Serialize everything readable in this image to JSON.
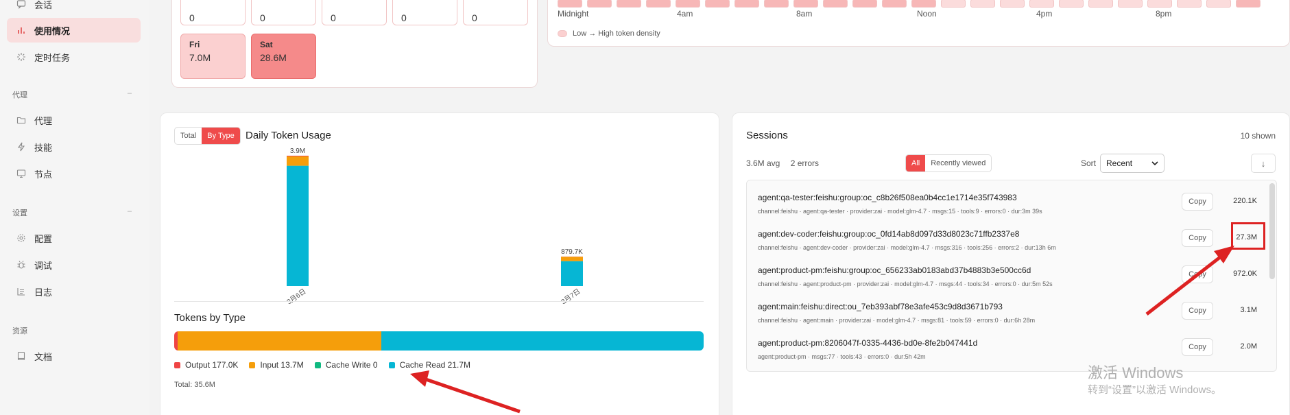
{
  "sidebar": {
    "items": [
      {
        "label": "会话",
        "icon": "chat-icon"
      },
      {
        "label": "使用情况",
        "icon": "bar-chart-icon",
        "active": true
      },
      {
        "label": "定时任务",
        "icon": "spinner-icon"
      }
    ],
    "sections": [
      {
        "title": "代理",
        "items": [
          {
            "label": "代理",
            "icon": "folder-icon"
          },
          {
            "label": "技能",
            "icon": "bolt-icon"
          },
          {
            "label": "节点",
            "icon": "monitor-icon"
          }
        ]
      },
      {
        "title": "设置",
        "items": [
          {
            "label": "配置",
            "icon": "gear-icon"
          },
          {
            "label": "调试",
            "icon": "bug-icon"
          },
          {
            "label": "日志",
            "icon": "log-icon"
          }
        ]
      },
      {
        "title": "资源",
        "items": [
          {
            "label": "文档",
            "icon": "book-icon"
          }
        ]
      }
    ]
  },
  "day_cards": {
    "top_row": [
      "0",
      "0",
      "0",
      "0",
      "0"
    ],
    "fri": {
      "name": "Fri",
      "value": "7.0M"
    },
    "sat": {
      "name": "Sat",
      "value": "28.6M"
    }
  },
  "hourly": {
    "labels": [
      "Midnight",
      "4am",
      "8am",
      "Noon",
      "4pm",
      "8pm"
    ],
    "legend": "Low → High token density"
  },
  "usage": {
    "toggle_total": "Total",
    "toggle_by_type": "By Type",
    "title": "Daily Token Usage",
    "tokens_by_type_title": "Tokens by Type",
    "legend": [
      {
        "label": "Output 177.0K",
        "color": "#ef4444"
      },
      {
        "label": "Input 13.7M",
        "color": "#f59e0b"
      },
      {
        "label": "Cache Write 0",
        "color": "#10b981"
      },
      {
        "label": "Cache Read 21.7M",
        "color": "#06b6d4"
      }
    ],
    "total": "Total: 35.6M"
  },
  "chart_data": {
    "type": "bar",
    "stacked": true,
    "categories": [
      "3月6日",
      "3月7日"
    ],
    "totals_labels": [
      "3.9M",
      "879.7K"
    ],
    "series": [
      {
        "name": "Output",
        "color": "#ef4444",
        "values": [
          0.02,
          0.005
        ]
      },
      {
        "name": "Input",
        "color": "#f59e0b",
        "values": [
          0.28,
          0.13
        ]
      },
      {
        "name": "Cache Write",
        "color": "#10b981",
        "values": [
          0,
          0
        ]
      },
      {
        "name": "Cache Read",
        "color": "#06b6d4",
        "values": [
          3.6,
          0.745
        ]
      }
    ],
    "ylim": [
      0,
      3.9
    ],
    "type_breakdown": [
      {
        "name": "Output",
        "value": 177.0,
        "unit": "K",
        "color": "#ef4444"
      },
      {
        "name": "Input",
        "value": 13.7,
        "unit": "M",
        "color": "#f59e0b"
      },
      {
        "name": "Cache Write",
        "value": 0,
        "unit": "",
        "color": "#10b981"
      },
      {
        "name": "Cache Read",
        "value": 21.7,
        "unit": "M",
        "color": "#06b6d4"
      }
    ]
  },
  "sessions": {
    "title": "Sessions",
    "shown": "10 shown",
    "avg": "3.6M avg",
    "errors": "2 errors",
    "filter_all": "All",
    "filter_recent": "Recently viewed",
    "sort_label": "Sort",
    "sort_value": "Recent",
    "download_icon": "↓",
    "copy_label": "Copy",
    "rows": [
      {
        "key": "agent:qa-tester:feishu:group:oc_c8b26f508ea0b4cc1e1714e35f743983",
        "sub": "channel:feishu · agent:qa-tester · provider:zai · model:glm-4.7 · msgs:15 · tools:9 · errors:0 · dur:3m 39s",
        "tokens": "220.1K"
      },
      {
        "key": "agent:dev-coder:feishu:group:oc_0fd14ab8d097d33d8023c71ffb2337e8",
        "sub": "channel:feishu · agent:dev-coder · provider:zai · model:glm-4.7 · msgs:316 · tools:256 · errors:2 · dur:13h 6m",
        "tokens": "27.3M"
      },
      {
        "key": "agent:product-pm:feishu:group:oc_656233ab0183abd37b4883b3e500cc6d",
        "sub": "channel:feishu · agent:product-pm · provider:zai · model:glm-4.7 · msgs:44 · tools:34 · errors:0 · dur:5m 52s",
        "tokens": "972.0K"
      },
      {
        "key": "agent:main:feishu:direct:ou_7eb393abf78e3afe453c9d8d3671b793",
        "sub": "channel:feishu · agent:main · provider:zai · model:glm-4.7 · msgs:81 · tools:59 · errors:0 · dur:6h 28m",
        "tokens": "3.1M"
      },
      {
        "key": "agent:product-pm:8206047f-0335-4436-bd0e-8fe2b047441d",
        "sub": "agent:product-pm · msgs:77 · tools:43 · errors:0 · dur:5h 42m",
        "tokens": "2.0M"
      }
    ]
  },
  "watermark": {
    "line1": "激活 Windows",
    "line2": "转到“设置”以激活 Windows。"
  },
  "colors": {
    "accent": "#ef4b4b",
    "annotation": "#dd2222"
  }
}
